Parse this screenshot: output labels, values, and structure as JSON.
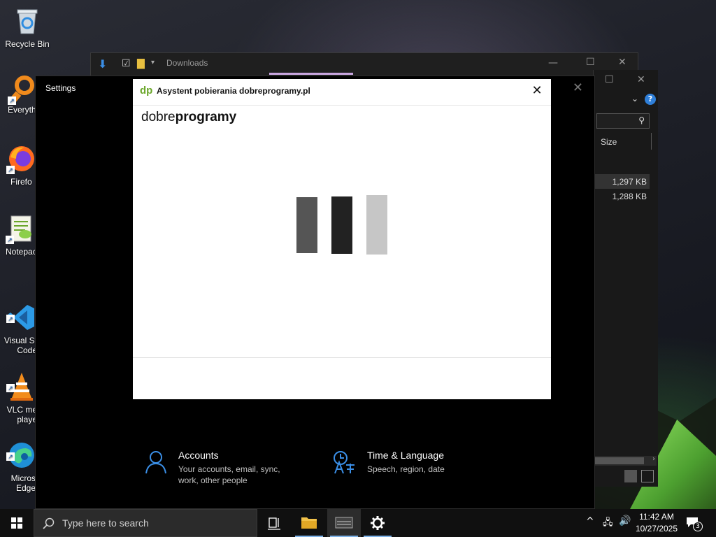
{
  "desktop": {
    "icons": [
      {
        "label": "Recycle Bin",
        "icon": "recycle-bin-icon"
      },
      {
        "label": "Everyth",
        "icon": "everything-search-icon"
      },
      {
        "label": "Firefo",
        "icon": "firefox-icon"
      },
      {
        "label": "Notepac",
        "icon": "notepad-plus-plus-icon"
      },
      {
        "label": "Visual St\nCode",
        "icon": "vscode-icon"
      },
      {
        "label": "VLC me\nplaye",
        "icon": "vlc-icon"
      },
      {
        "label": "Micros\nEdge",
        "icon": "edge-icon"
      }
    ]
  },
  "explorer": {
    "title": "Downloads",
    "size_header": "Size",
    "rows": [
      {
        "size": "1,297 KB"
      },
      {
        "size": "1,288 KB"
      }
    ]
  },
  "settings": {
    "title": "Settings",
    "items": [
      {
        "name": "Accounts",
        "desc": "Your accounts, email, sync, work, other people",
        "icon": "person-icon"
      },
      {
        "name": "Time & Language",
        "desc": "Speech, region, date",
        "icon": "time-language-icon"
      }
    ]
  },
  "dialog": {
    "logo": "dp",
    "title": "Asystent pobierania dobreprogramy.pl",
    "brand_light": "dobre",
    "brand_bold": "programy",
    "close": "✕",
    "loader_colors": [
      "#555555",
      "#222222",
      "#c6c6c6"
    ]
  },
  "taskbar": {
    "search_placeholder": "Type here to search",
    "time": "11:42 AM",
    "date": "10/27/2025",
    "notification_count": "3"
  },
  "colors": {
    "accent": "#3a8ee6",
    "brand_green": "#6aa62a"
  }
}
